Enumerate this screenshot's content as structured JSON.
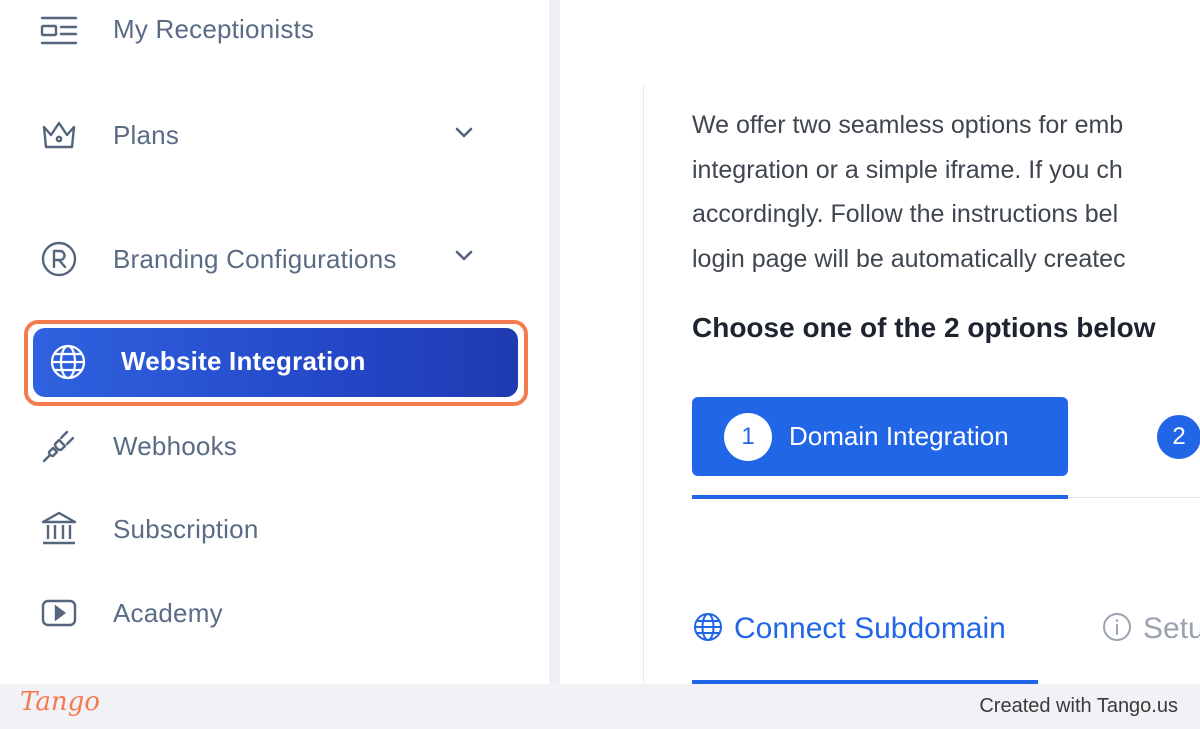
{
  "sidebar": {
    "items": [
      {
        "label": "My Receptionists",
        "icon": "list-icon"
      },
      {
        "label": "Plans",
        "icon": "crown-icon"
      },
      {
        "label": "Branding Configurations",
        "icon": "registered-icon"
      },
      {
        "label": "Website Integration",
        "icon": "globe-icon",
        "active": true
      },
      {
        "label": "Webhooks",
        "icon": "plug-icon"
      },
      {
        "label": "Subscription",
        "icon": "bank-icon"
      },
      {
        "label": "Academy",
        "icon": "video-icon"
      }
    ]
  },
  "main": {
    "paragraph_lines": [
      "We offer two seamless options for emb",
      "integration or a simple iframe. If you ch",
      "accordingly. Follow the instructions bel",
      "login page will be automatically createc"
    ],
    "choose_heading": "Choose one of the 2 options below",
    "steps": [
      {
        "number": "1",
        "label": "Domain Integration"
      },
      {
        "number": "2",
        "label": ""
      }
    ],
    "sub_tabs": [
      {
        "label": "Connect Subdomain",
        "icon": "globe-icon"
      },
      {
        "label": "Setu",
        "icon": "info-icon"
      }
    ]
  },
  "footer": {
    "logo": "Tango",
    "credit": "Created with Tango.us"
  },
  "colors": {
    "accent": "#2266e8",
    "highlight": "#f47b4f",
    "nav_text": "#5a6b85"
  }
}
